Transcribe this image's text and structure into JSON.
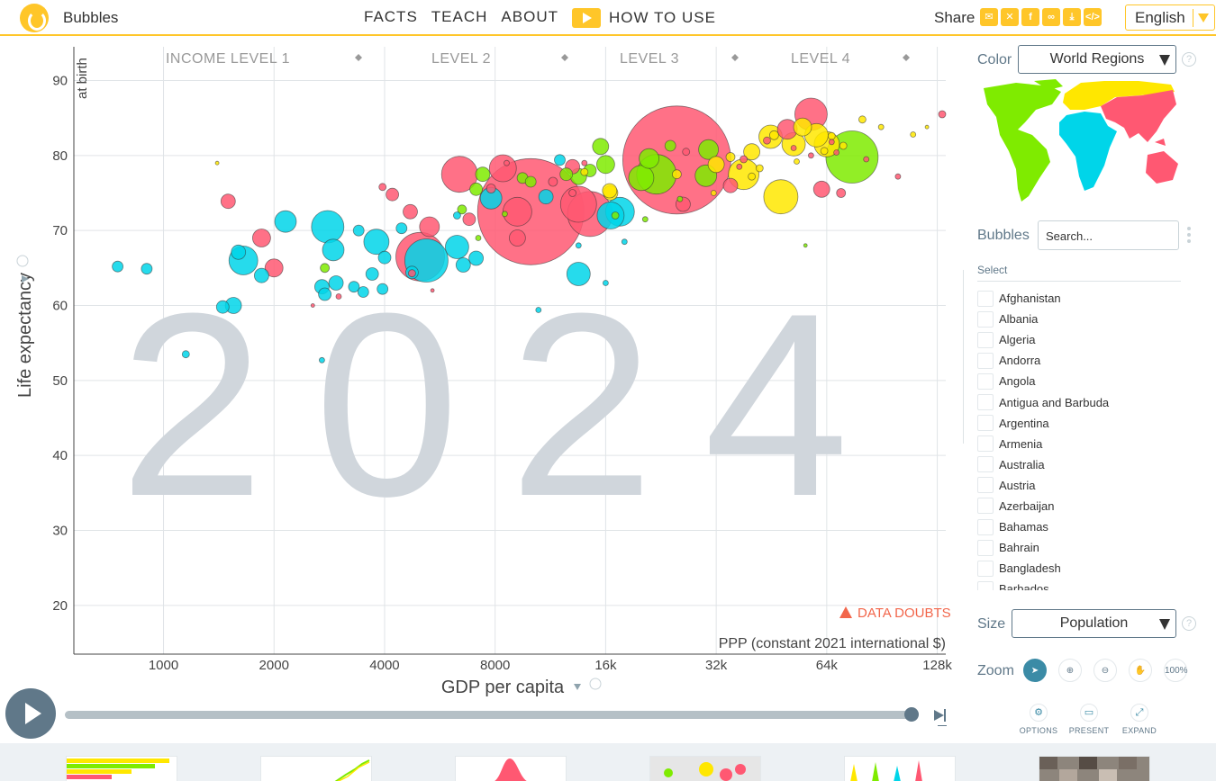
{
  "header": {
    "app_title": "Bubbles",
    "nav": {
      "facts": "FACTS",
      "teach": "TEACH",
      "about": "ABOUT",
      "how_to_use": "HOW TO USE"
    },
    "share_label": "Share",
    "share_icons": [
      "mail-icon",
      "twitter-icon",
      "facebook-icon",
      "link-icon",
      "download-icon",
      "embed-icon"
    ],
    "language": "English",
    "accent_color": "#ffc629"
  },
  "chart": {
    "year": "2024",
    "income_levels": [
      "INCOME LEVEL 1",
      "LEVEL 2",
      "LEVEL 3",
      "LEVEL 4"
    ],
    "data_doubts": "DATA DOUBTS",
    "x_unit": "PPP (constant 2021 international $)",
    "x_title": "GDP per capita",
    "y_title": "Life expectancy",
    "y_subtitle": "at birth"
  },
  "chart_data": {
    "type": "scatter",
    "x_scale": "log",
    "xlabel": "GDP per capita",
    "ylabel": "Life expectancy",
    "x_ticks": [
      "1000",
      "2000",
      "4000",
      "8000",
      "16k",
      "32k",
      "64k",
      "128k"
    ],
    "x_tick_values": [
      1000,
      2000,
      4000,
      8000,
      16000,
      32000,
      64000,
      128000
    ],
    "y_ticks": [
      20,
      30,
      40,
      50,
      60,
      70,
      80,
      90
    ],
    "xlim": [
      570,
      135000
    ],
    "ylim": [
      13.5,
      94.5
    ],
    "color_by": "World Regions",
    "size_by": "Population",
    "region_colors": {
      "africa": "#00d5e9",
      "americas": "#7feb00",
      "asia": "#ff5872",
      "europe": "#ffe700"
    },
    "points": [
      {
        "x": 1400,
        "y": 79.0,
        "r": 2,
        "region": "europe"
      },
      {
        "x": 5000,
        "y": 66.5,
        "r": 27,
        "region": "asia"
      },
      {
        "x": 10000,
        "y": 72.5,
        "r": 59,
        "region": "asia"
      },
      {
        "x": 25000,
        "y": 79.4,
        "r": 60,
        "region": "asia"
      },
      {
        "x": 5200,
        "y": 66.0,
        "r": 24,
        "region": "africa"
      },
      {
        "x": 75000,
        "y": 79.8,
        "r": 29,
        "region": "americas"
      },
      {
        "x": 22000,
        "y": 77.5,
        "r": 22,
        "region": "americas"
      },
      {
        "x": 14500,
        "y": 72.2,
        "r": 25,
        "region": "asia"
      },
      {
        "x": 13500,
        "y": 73.5,
        "r": 20,
        "region": "asia"
      },
      {
        "x": 6400,
        "y": 77.5,
        "r": 20,
        "region": "asia"
      },
      {
        "x": 58000,
        "y": 85.5,
        "r": 18,
        "region": "asia"
      },
      {
        "x": 48000,
        "y": 74.5,
        "r": 19,
        "region": "europe"
      },
      {
        "x": 2800,
        "y": 70.5,
        "r": 18,
        "region": "africa"
      },
      {
        "x": 1650,
        "y": 66.0,
        "r": 16,
        "region": "africa"
      },
      {
        "x": 17500,
        "y": 72.5,
        "r": 16,
        "region": "africa"
      },
      {
        "x": 38000,
        "y": 77.5,
        "r": 17,
        "region": "europe"
      },
      {
        "x": 6300,
        "y": 67.8,
        "r": 13,
        "region": "africa"
      },
      {
        "x": 3800,
        "y": 68.5,
        "r": 14,
        "region": "africa"
      },
      {
        "x": 2900,
        "y": 67.4,
        "r": 12,
        "region": "africa"
      },
      {
        "x": 2150,
        "y": 71.2,
        "r": 12,
        "region": "africa"
      },
      {
        "x": 13500,
        "y": 64.2,
        "r": 13,
        "region": "africa"
      },
      {
        "x": 16500,
        "y": 72.0,
        "r": 15,
        "region": "africa"
      },
      {
        "x": 20000,
        "y": 77.0,
        "r": 14,
        "region": "americas"
      },
      {
        "x": 21000,
        "y": 79.6,
        "r": 11,
        "region": "americas"
      },
      {
        "x": 30000,
        "y": 77.3,
        "r": 12,
        "region": "americas"
      },
      {
        "x": 30500,
        "y": 80.8,
        "r": 11,
        "region": "americas"
      },
      {
        "x": 15500,
        "y": 81.2,
        "r": 9,
        "region": "americas"
      },
      {
        "x": 8400,
        "y": 78.3,
        "r": 15,
        "region": "asia"
      },
      {
        "x": 7800,
        "y": 74.3,
        "r": 12,
        "region": "africa"
      },
      {
        "x": 9200,
        "y": 72.5,
        "r": 16,
        "region": "asia"
      },
      {
        "x": 5300,
        "y": 70.5,
        "r": 11,
        "region": "asia"
      },
      {
        "x": 1500,
        "y": 73.9,
        "r": 8,
        "region": "asia"
      },
      {
        "x": 2000,
        "y": 65.0,
        "r": 10,
        "region": "asia"
      },
      {
        "x": 1850,
        "y": 69.0,
        "r": 10,
        "region": "asia"
      },
      {
        "x": 4700,
        "y": 72.5,
        "r": 8,
        "region": "asia"
      },
      {
        "x": 4200,
        "y": 74.8,
        "r": 7,
        "region": "asia"
      },
      {
        "x": 9200,
        "y": 69.0,
        "r": 9,
        "region": "asia"
      },
      {
        "x": 45000,
        "y": 82.5,
        "r": 13,
        "region": "europe"
      },
      {
        "x": 52000,
        "y": 81.5,
        "r": 13,
        "region": "europe"
      },
      {
        "x": 60000,
        "y": 82.7,
        "r": 13,
        "region": "europe"
      },
      {
        "x": 64000,
        "y": 81.5,
        "r": 14,
        "region": "europe"
      },
      {
        "x": 50000,
        "y": 83.5,
        "r": 11,
        "region": "asia"
      },
      {
        "x": 55000,
        "y": 83.8,
        "r": 10,
        "region": "europe"
      },
      {
        "x": 62000,
        "y": 75.5,
        "r": 9,
        "region": "asia"
      },
      {
        "x": 32000,
        "y": 78.8,
        "r": 9,
        "region": "europe"
      },
      {
        "x": 40000,
        "y": 80.5,
        "r": 9,
        "region": "europe"
      },
      {
        "x": 35000,
        "y": 76.0,
        "r": 8,
        "region": "asia"
      },
      {
        "x": 26000,
        "y": 73.5,
        "r": 8,
        "region": "asia"
      },
      {
        "x": 16500,
        "y": 75.0,
        "r": 8,
        "region": "europe"
      },
      {
        "x": 13500,
        "y": 77.2,
        "r": 9,
        "region": "americas"
      },
      {
        "x": 12500,
        "y": 77.5,
        "r": 7,
        "region": "americas"
      },
      {
        "x": 13000,
        "y": 78.5,
        "r": 8,
        "region": "asia"
      },
      {
        "x": 7100,
        "y": 75.5,
        "r": 7,
        "region": "americas"
      },
      {
        "x": 7400,
        "y": 77.5,
        "r": 8,
        "region": "americas"
      },
      {
        "x": 16000,
        "y": 78.8,
        "r": 10,
        "region": "americas"
      },
      {
        "x": 16400,
        "y": 75.3,
        "r": 8,
        "region": "europe"
      },
      {
        "x": 900,
        "y": 64.9,
        "r": 6,
        "region": "africa"
      },
      {
        "x": 750,
        "y": 65.2,
        "r": 6,
        "region": "africa"
      },
      {
        "x": 1450,
        "y": 59.8,
        "r": 7,
        "region": "africa"
      },
      {
        "x": 1550,
        "y": 60.0,
        "r": 9,
        "region": "africa"
      },
      {
        "x": 1150,
        "y": 53.5,
        "r": 4,
        "region": "africa"
      },
      {
        "x": 1850,
        "y": 64.0,
        "r": 8,
        "region": "africa"
      },
      {
        "x": 1600,
        "y": 67.1,
        "r": 8,
        "region": "africa"
      },
      {
        "x": 2700,
        "y": 62.5,
        "r": 8,
        "region": "africa"
      },
      {
        "x": 2950,
        "y": 63.0,
        "r": 8,
        "region": "africa"
      },
      {
        "x": 3300,
        "y": 62.5,
        "r": 6,
        "region": "africa"
      },
      {
        "x": 3500,
        "y": 61.8,
        "r": 6,
        "region": "africa"
      },
      {
        "x": 3700,
        "y": 64.2,
        "r": 7,
        "region": "africa"
      },
      {
        "x": 3950,
        "y": 62.2,
        "r": 6,
        "region": "africa"
      },
      {
        "x": 2750,
        "y": 61.5,
        "r": 7,
        "region": "africa"
      },
      {
        "x": 4450,
        "y": 70.3,
        "r": 6,
        "region": "africa"
      },
      {
        "x": 4000,
        "y": 66.4,
        "r": 7,
        "region": "africa"
      },
      {
        "x": 7100,
        "y": 66.3,
        "r": 8,
        "region": "africa"
      },
      {
        "x": 6550,
        "y": 65.4,
        "r": 8,
        "region": "africa"
      },
      {
        "x": 4750,
        "y": 64.4,
        "r": 7,
        "region": "africa"
      },
      {
        "x": 3400,
        "y": 70.0,
        "r": 6,
        "region": "africa"
      },
      {
        "x": 2700,
        "y": 52.7,
        "r": 3,
        "region": "africa"
      },
      {
        "x": 12000,
        "y": 79.4,
        "r": 6,
        "region": "africa"
      },
      {
        "x": 11000,
        "y": 74.5,
        "r": 8,
        "region": "africa"
      },
      {
        "x": 18000,
        "y": 68.5,
        "r": 3,
        "region": "africa"
      },
      {
        "x": 10500,
        "y": 59.4,
        "r": 3,
        "region": "africa"
      },
      {
        "x": 6300,
        "y": 72.0,
        "r": 4,
        "region": "africa"
      },
      {
        "x": 13500,
        "y": 68.0,
        "r": 3,
        "region": "africa"
      },
      {
        "x": 16000,
        "y": 63.0,
        "r": 3,
        "region": "africa"
      },
      {
        "x": 2750,
        "y": 65.0,
        "r": 5,
        "region": "americas"
      },
      {
        "x": 6500,
        "y": 72.8,
        "r": 5,
        "region": "americas"
      },
      {
        "x": 7200,
        "y": 69.0,
        "r": 3,
        "region": "americas"
      },
      {
        "x": 9500,
        "y": 77.0,
        "r": 6,
        "region": "americas"
      },
      {
        "x": 10000,
        "y": 76.5,
        "r": 6,
        "region": "americas"
      },
      {
        "x": 14500,
        "y": 78.0,
        "r": 7,
        "region": "americas"
      },
      {
        "x": 24000,
        "y": 81.3,
        "r": 6,
        "region": "americas"
      },
      {
        "x": 17000,
        "y": 72.0,
        "r": 4,
        "region": "americas"
      },
      {
        "x": 56000,
        "y": 68.0,
        "r": 2,
        "region": "americas"
      },
      {
        "x": 20500,
        "y": 71.5,
        "r": 3,
        "region": "americas"
      },
      {
        "x": 6800,
        "y": 71.5,
        "r": 7,
        "region": "asia"
      },
      {
        "x": 3950,
        "y": 75.8,
        "r": 4,
        "region": "asia"
      },
      {
        "x": 4750,
        "y": 64.3,
        "r": 4,
        "region": "asia"
      },
      {
        "x": 7800,
        "y": 75.6,
        "r": 5,
        "region": "asia"
      },
      {
        "x": 11500,
        "y": 76.5,
        "r": 5,
        "region": "asia"
      },
      {
        "x": 13000,
        "y": 75.0,
        "r": 4,
        "region": "asia"
      },
      {
        "x": 26500,
        "y": 80.5,
        "r": 4,
        "region": "asia"
      },
      {
        "x": 38000,
        "y": 79.5,
        "r": 4,
        "region": "asia"
      },
      {
        "x": 37000,
        "y": 78.5,
        "r": 3,
        "region": "asia"
      },
      {
        "x": 44000,
        "y": 82.0,
        "r": 4,
        "region": "asia"
      },
      {
        "x": 52000,
        "y": 81.0,
        "r": 3,
        "region": "asia"
      },
      {
        "x": 58000,
        "y": 80.0,
        "r": 3,
        "region": "asia"
      },
      {
        "x": 66000,
        "y": 81.8,
        "r": 3,
        "region": "asia"
      },
      {
        "x": 68000,
        "y": 80.4,
        "r": 3,
        "region": "asia"
      },
      {
        "x": 70000,
        "y": 75.0,
        "r": 5,
        "region": "asia"
      },
      {
        "x": 82000,
        "y": 79.5,
        "r": 3,
        "region": "asia"
      },
      {
        "x": 100000,
        "y": 77.2,
        "r": 3,
        "region": "asia"
      },
      {
        "x": 132000,
        "y": 85.5,
        "r": 4,
        "region": "asia"
      },
      {
        "x": 3000,
        "y": 61.2,
        "r": 3,
        "region": "asia"
      },
      {
        "x": 2550,
        "y": 60.0,
        "r": 2,
        "region": "asia"
      },
      {
        "x": 5400,
        "y": 62.0,
        "r": 2,
        "region": "asia"
      },
      {
        "x": 25000,
        "y": 77.5,
        "r": 5,
        "region": "europe"
      },
      {
        "x": 31500,
        "y": 75.0,
        "r": 3,
        "region": "europe"
      },
      {
        "x": 40000,
        "y": 77.2,
        "r": 4,
        "region": "europe"
      },
      {
        "x": 42000,
        "y": 78.3,
        "r": 4,
        "region": "europe"
      },
      {
        "x": 46000,
        "y": 82.7,
        "r": 5,
        "region": "europe"
      },
      {
        "x": 63000,
        "y": 80.6,
        "r": 4,
        "region": "europe"
      },
      {
        "x": 66000,
        "y": 82.6,
        "r": 4,
        "region": "europe"
      },
      {
        "x": 71000,
        "y": 81.3,
        "r": 4,
        "region": "europe"
      },
      {
        "x": 80000,
        "y": 84.8,
        "r": 4,
        "region": "europe"
      },
      {
        "x": 90000,
        "y": 83.8,
        "r": 3,
        "region": "europe"
      },
      {
        "x": 110000,
        "y": 82.8,
        "r": 3,
        "region": "europe"
      },
      {
        "x": 120000,
        "y": 83.8,
        "r": 2,
        "region": "europe"
      },
      {
        "x": 35000,
        "y": 79.8,
        "r": 5,
        "region": "europe"
      },
      {
        "x": 53000,
        "y": 79.2,
        "r": 3,
        "region": "europe"
      },
      {
        "x": 14000,
        "y": 77.8,
        "r": 4,
        "region": "europe"
      },
      {
        "x": 25500,
        "y": 74.2,
        "r": 3,
        "region": "americas"
      },
      {
        "x": 14000,
        "y": 79.0,
        "r": 3,
        "region": "asia"
      },
      {
        "x": 8600,
        "y": 79.0,
        "r": 3,
        "region": "asia"
      },
      {
        "x": 8500,
        "y": 72.2,
        "r": 3,
        "region": "americas"
      }
    ]
  },
  "controls": {
    "color_label": "Color",
    "color_value": "World Regions",
    "bubbles_label": "Bubbles",
    "search_placeholder": "Search...",
    "select_header": "Select",
    "countries": [
      "Afghanistan",
      "Albania",
      "Algeria",
      "Andorra",
      "Angola",
      "Antigua and Barbuda",
      "Argentina",
      "Armenia",
      "Australia",
      "Austria",
      "Azerbaijan",
      "Bahamas",
      "Bahrain",
      "Bangladesh",
      "Barbados"
    ],
    "size_label": "Size",
    "size_value": "Population",
    "zoom_label": "Zoom",
    "zoom_100": "100%",
    "options_label": "OPTIONS",
    "present_label": "PRESENT",
    "expand_label": "EXPAND",
    "help_glyph": "?"
  },
  "timeslider": {
    "progress": 1.0
  }
}
